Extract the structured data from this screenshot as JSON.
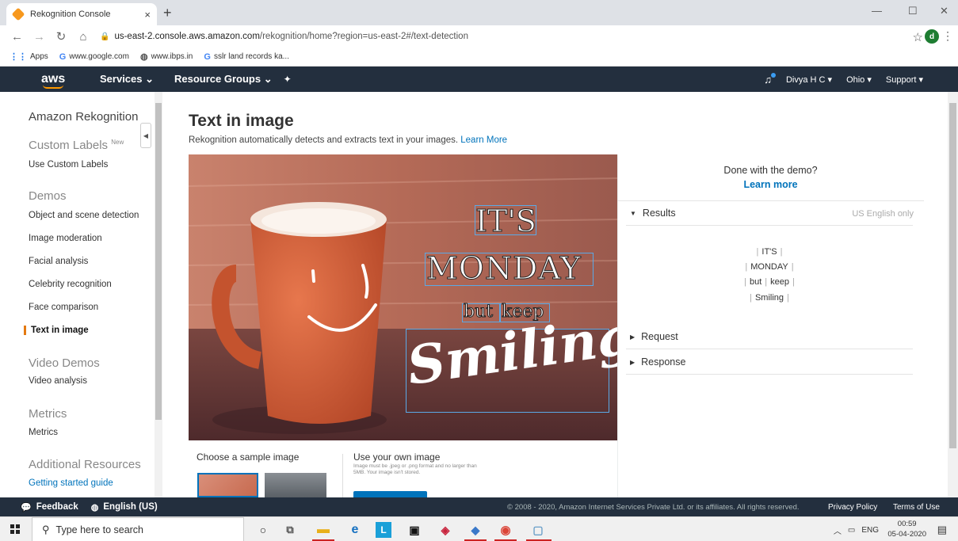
{
  "browser": {
    "tab_title": "Rekognition Console",
    "tab_close": "×",
    "new_tab": "+",
    "url_host": "us-east-2.console.aws.amazon.com",
    "url_path": "/rekognition/home?region=us-east-2#/text-detection",
    "bookmarks": [
      {
        "label": "Apps",
        "icon": "apps-grid-icon"
      },
      {
        "label": "www.google.com",
        "icon": "google-g-icon"
      },
      {
        "label": "www.ibps.in",
        "icon": "globe-icon"
      },
      {
        "label": "sslr land records ka...",
        "icon": "google-g-icon"
      }
    ],
    "profile_initial": "d"
  },
  "aws_nav": {
    "logo": "aws",
    "services": "Services ⌄",
    "resource_groups": "Resource Groups ⌄",
    "user": "Divya H C ▾",
    "region": "Ohio ▾",
    "support": "Support ▾"
  },
  "sidebar": {
    "title": "Amazon Rekognition",
    "custom_labels_heading": "Custom Labels",
    "new_badge": "New",
    "use_custom_labels": "Use Custom Labels",
    "demos_heading": "Demos",
    "demos": [
      "Object and scene detection",
      "Image moderation",
      "Facial analysis",
      "Celebrity recognition",
      "Face comparison",
      "Text in image"
    ],
    "video_demos_heading": "Video Demos",
    "video_analysis": "Video analysis",
    "metrics_heading": "Metrics",
    "metrics": "Metrics",
    "additional_heading": "Additional Resources",
    "getting_started": "Getting started guide"
  },
  "main": {
    "title": "Text in image",
    "subtitle": "Rekognition automatically detects and extracts text in your images.",
    "subtitle_link": "Learn More",
    "image_words": [
      "IT'S",
      "MONDAY",
      "but",
      "keep",
      "Smiling"
    ],
    "done_question": "Done with the demo?",
    "learn_more": "Learn more",
    "results_label": "Results",
    "language_note": "US English only",
    "result_lines": [
      [
        "IT'S"
      ],
      [
        "MONDAY"
      ],
      [
        "but",
        "keep"
      ],
      [
        "Smiling"
      ]
    ],
    "request_label": "Request",
    "response_label": "Response",
    "choose_sample": "Choose a sample image",
    "use_own": "Use your own image",
    "own_note": "Image must be .jpeg or .png format and no larger than 5MB. Your image isn't stored."
  },
  "footer": {
    "feedback": "Feedback",
    "language": "English (US)",
    "copyright": "© 2008 - 2020, Amazon Internet Services Private Ltd. or its affiliates. All rights reserved.",
    "privacy": "Privacy Policy",
    "terms": "Terms of Use"
  },
  "taskbar": {
    "search_placeholder": "Type here to search",
    "lang": "ENG",
    "time": "00:59",
    "date": "05-04-2020"
  },
  "colors": {
    "aws_nav": "#232f3e",
    "aws_orange": "#f90",
    "link_blue": "#0073bb",
    "active_marker": "#e47911",
    "bbox_blue": "#5aa9e6"
  }
}
